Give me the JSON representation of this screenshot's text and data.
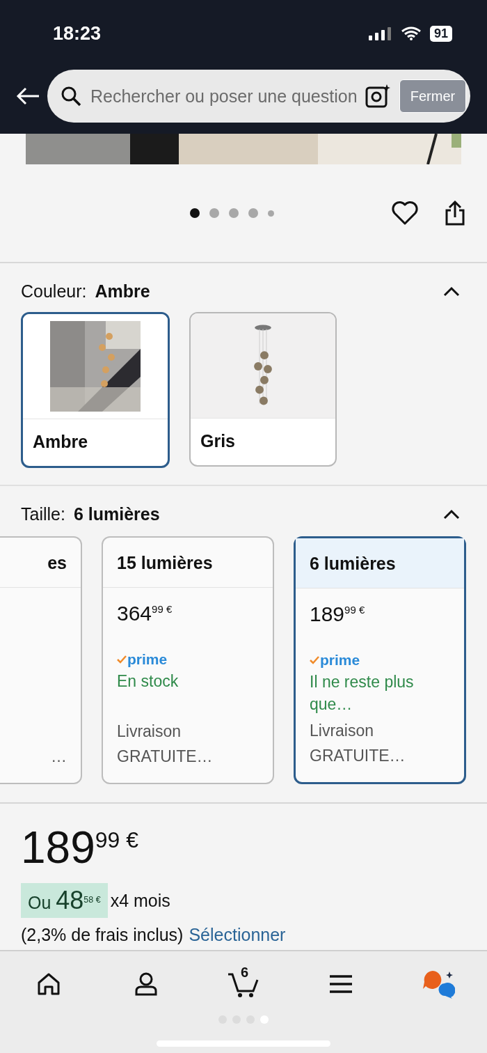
{
  "status_bar": {
    "time": "18:23",
    "battery": "91"
  },
  "search": {
    "placeholder": "Rechercher ou poser une question",
    "overlay_button": "Fermer"
  },
  "gallery": {
    "dots": [
      {
        "selected": true
      },
      {
        "selected": false
      },
      {
        "selected": false
      },
      {
        "selected": false
      },
      {
        "selected": false
      }
    ]
  },
  "color": {
    "label": "Couleur:",
    "value": "Ambre",
    "expanded": true,
    "options": [
      {
        "name": "Ambre",
        "selected": true,
        "kind": "picture"
      },
      {
        "name": "Gris",
        "selected": false,
        "kind": "picture"
      }
    ]
  },
  "size": {
    "label": "Taille:",
    "value": "6 lumières",
    "expanded": true,
    "options": [
      {
        "title": "es",
        "delivery": "…",
        "selected": false
      },
      {
        "title": "15 lumières",
        "price": "364",
        "cents": "99 €",
        "prime": "prime",
        "stock": "En stock",
        "delivery": "Livraison GRATUITE…",
        "selected": false
      },
      {
        "title": "6 lumières",
        "price": "189",
        "cents": "99 €",
        "prime": "prime",
        "stock": "Il ne reste plus que…",
        "delivery": "Livraison GRATUITE…",
        "selected": true
      }
    ]
  },
  "price": {
    "whole": "189",
    "cents": "99 €",
    "installment_prefix": "Ou",
    "installment_whole": "48",
    "installment_cents": "58 €",
    "installment_suffix": "x4 mois",
    "fees": "(2,3% de frais inclus)",
    "link": "Sélectionner"
  },
  "bottom_nav": [
    {
      "kind": "home"
    },
    {
      "kind": "account"
    },
    {
      "kind": "cart",
      "badge": "6"
    },
    {
      "kind": "menu"
    },
    {
      "kind": "assistant"
    }
  ],
  "page_dots": [
    {
      "selected": false
    },
    {
      "selected": false
    },
    {
      "selected": false
    },
    {
      "selected": true
    }
  ]
}
